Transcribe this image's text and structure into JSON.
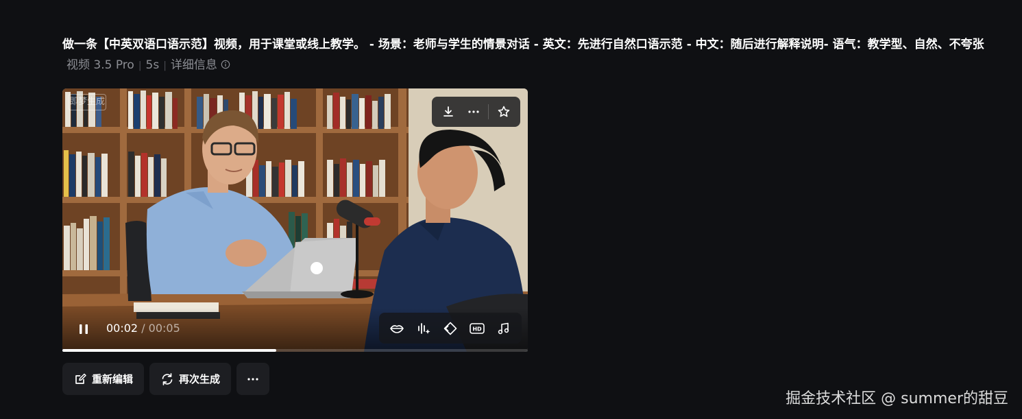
{
  "prompt": {
    "text": "做一条【中英双语口语示范】视频，用于课堂或线上教学。 - 场景：老师与学生的情景对话 - 英文：先进行自然口语示范 - 中文：随后进行解释说明- 语气：教学型、自然、不夸张",
    "model": "视频 3.5 Pro",
    "duration": "5s",
    "details_label": "详细信息"
  },
  "player": {
    "watermark": "即梦生成",
    "current_time": "00:02",
    "total_time": "00:05",
    "progress": 0.46,
    "top_icons": [
      "download-icon",
      "more-icon",
      "star-icon"
    ],
    "bottom_icons": [
      "lip-sync-icon",
      "audio-wave-icon",
      "frame-icon",
      "hd-icon",
      "music-icon"
    ]
  },
  "actions": {
    "re_edit": "重新编辑",
    "regenerate": "再次生成"
  },
  "site_watermark": "掘金技术社区 @ summer的甜豆"
}
